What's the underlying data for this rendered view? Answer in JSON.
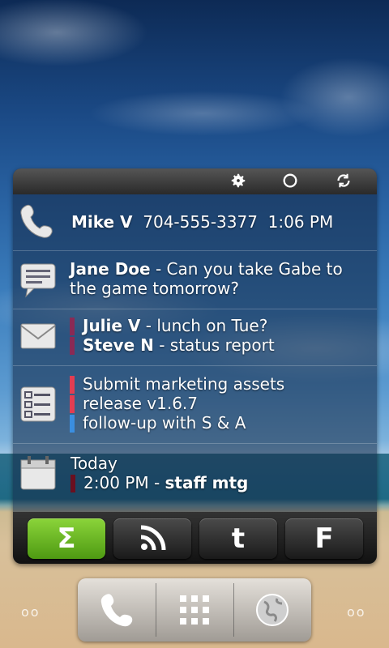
{
  "widget": {
    "call": {
      "name": "Mike V",
      "number": "704-555-3377",
      "time": "1:06 PM"
    },
    "sms": {
      "sender": "Jane Doe",
      "message": " - Can you take Gabe to the game tomorrow?"
    },
    "email": [
      {
        "sender": "Julie V",
        "subject": " - lunch on Tue?",
        "color": "#8a2a55"
      },
      {
        "sender": "Steve N",
        "subject": " - status report",
        "color": "#8a2a55"
      }
    ],
    "tasks": [
      {
        "text": "Submit marketing assets",
        "color": "#e23d52"
      },
      {
        "text": "release v1.6.7",
        "color": "#e23d52"
      },
      {
        "text": "follow-up with S & A",
        "color": "#3a8ee0"
      }
    ],
    "calendar": {
      "day": "Today",
      "time": "2:00 PM",
      "title": "staff mtg",
      "color": "#6a1020"
    }
  },
  "toolbar": {
    "icons": [
      "gear-icon",
      "circle-icon",
      "refresh-icon"
    ]
  },
  "tabs": [
    {
      "name": "sigma",
      "glyph": "Σ",
      "active": true
    },
    {
      "name": "rss",
      "glyph": "",
      "active": false
    },
    {
      "name": "twitter",
      "glyph": "t",
      "active": false
    },
    {
      "name": "facebook",
      "glyph": "F",
      "active": false
    }
  ],
  "dock": {
    "icons": [
      "phone-icon",
      "app-grid-icon",
      "globe-icon"
    ]
  },
  "pager": {
    "left": "oo",
    "right": "oo"
  }
}
